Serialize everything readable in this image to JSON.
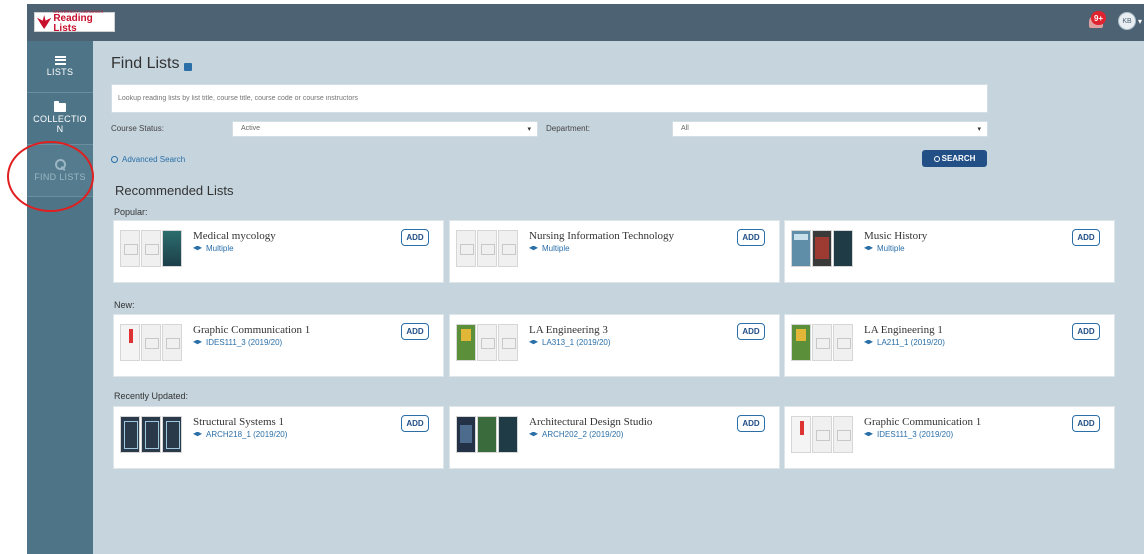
{
  "app": {
    "logo_small": "UNIVERSITY LIBRARIES",
    "logo_big": "Reading Lists",
    "notification_count": "9+",
    "user_initials": "KB"
  },
  "sidebar": {
    "items": [
      {
        "label": "LISTS",
        "icon": "list-icon"
      },
      {
        "label": "COLLECTION",
        "icon": "folder-icon"
      },
      {
        "label": "FIND LISTS",
        "icon": "search-icon",
        "active": true
      }
    ]
  },
  "main": {
    "title": "Find Lists",
    "search_placeholder": "Lookup reading lists by list title, course title, course code or course instructors",
    "course_status_label": "Course Status:",
    "course_status_value": "Active",
    "department_label": "Department:",
    "department_value": "All",
    "advanced_search": "Advanced Search",
    "search_button": "SEARCH",
    "recommended_title": "Recommended Lists"
  },
  "sections": [
    {
      "label": "Popular:",
      "cards": [
        {
          "title": "Medical mycology",
          "sub": "Multiple",
          "add": "ADD"
        },
        {
          "title": "Nursing Information Technology",
          "sub": "Multiple",
          "add": "ADD"
        },
        {
          "title": "Music History",
          "sub": "Multiple",
          "add": "ADD"
        }
      ]
    },
    {
      "label": "New:",
      "cards": [
        {
          "title": "Graphic Communication 1",
          "sub": "IDES111_3 (2019/20)",
          "add": "ADD"
        },
        {
          "title": "LA Engineering 3",
          "sub": "LA313_1 (2019/20)",
          "add": "ADD"
        },
        {
          "title": "LA Engineering 1",
          "sub": "LA211_1 (2019/20)",
          "add": "ADD"
        }
      ]
    },
    {
      "label": "Recently Updated:",
      "cards": [
        {
          "title": "Structural Systems 1",
          "sub": "ARCH218_1 (2019/20)",
          "add": "ADD"
        },
        {
          "title": "Architectural Design Studio",
          "sub": "ARCH202_2 (2019/20)",
          "add": "ADD"
        },
        {
          "title": "Graphic Communication 1",
          "sub": "IDES111_3 (2019/20)",
          "add": "ADD"
        }
      ]
    }
  ],
  "colors": {
    "topbar": "#4d6373",
    "sidebar": "#4d7587",
    "background": "#c5d4dd",
    "accent": "#2a6fa8",
    "search_button": "#214f86",
    "annotation": "#e01f1f"
  }
}
